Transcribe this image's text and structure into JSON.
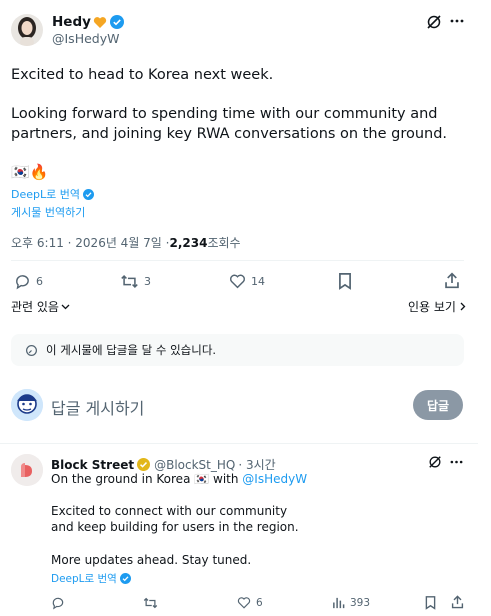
{
  "post": {
    "author_name": "Hedy",
    "handle": "@IsHedyW",
    "text_line1": "Excited to head to Korea next week.",
    "text_para2": "Looking forward to spending time with our community and partners, and joining key RWA conversations on the ground.",
    "emoji": "🇰🇷🔥",
    "translate_label": "DeepL로 번역",
    "translate_post_label": "게시물 번역하기",
    "timestamp": "오후 6:11 · 2026년 4월 7일 · ",
    "views_count": "2,234",
    "views_label": " 조회수",
    "actions": {
      "replies": "6",
      "reposts": "3",
      "likes": "14"
    },
    "related_label": "관련 있음",
    "quote_view_label": "인용 보기",
    "reply_restricted_notice": "이 게시물에 답글을 달 수 있습니다."
  },
  "composer": {
    "placeholder": "답글 게시하기",
    "reply_button": "답글"
  },
  "reply": {
    "author_name": "Block Street",
    "handle": "@BlockSt_HQ",
    "time": "· 3시간",
    "line1_prefix": "On the ground in Korea ",
    "line1_flag": "🇰🇷",
    "line1_with": " with ",
    "line1_mention": "@IsHedyW",
    "body_line1": "Excited to connect with our community",
    "body_line2": "and keep building for users in the region.",
    "body_line3": "More updates ahead. Stay tuned.",
    "translate_label": "DeepL로 번역",
    "actions": {
      "likes": "6",
      "views": "393"
    }
  },
  "colors": {
    "accent": "#1d9bf0",
    "verified": "#1d9bf0",
    "gold_verified": "#e2b719",
    "muted": "#536471",
    "heart_badge": "#f5a623"
  },
  "icons": [
    "grok-icon",
    "more-icon",
    "verified-icon",
    "heart-emoji-icon",
    "reply-icon",
    "repost-icon",
    "like-icon",
    "bookmark-icon",
    "share-icon",
    "chevron-down-icon",
    "chevron-right-icon",
    "reply-restrict-icon",
    "analytics-icon"
  ]
}
